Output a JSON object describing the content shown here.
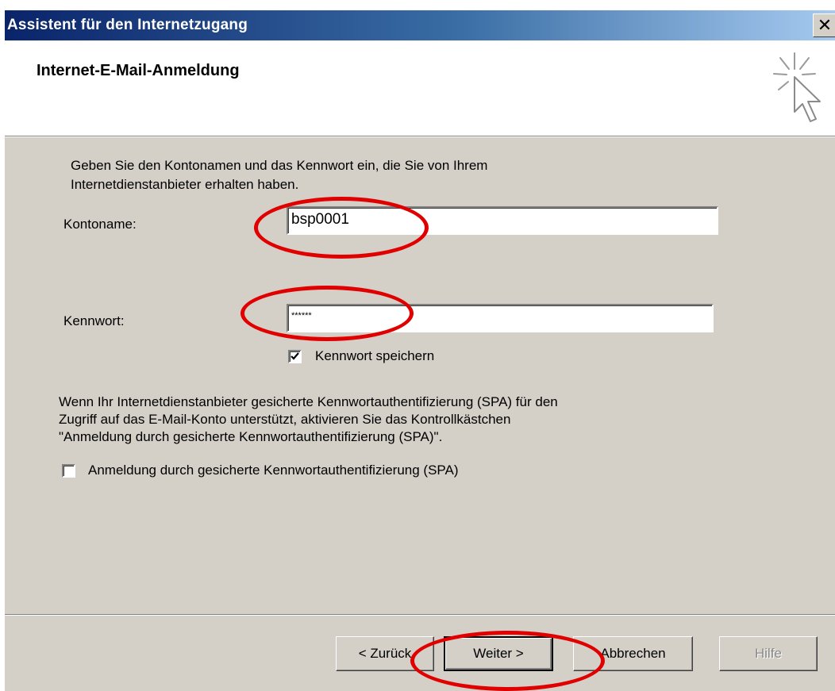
{
  "window": {
    "title": "Assistent für den Internetzugang",
    "close_glyph": "✕"
  },
  "header": {
    "title": "Internet-E-Mail-Anmeldung",
    "icon": "wizard-sparkle-cursor-icon"
  },
  "intro": {
    "line1": "Geben Sie den Kontonamen und das Kennwort ein, die Sie von Ihrem",
    "line2": "Internetdienstanbieter erhalten haben."
  },
  "account": {
    "label": "Kontoname:",
    "value": "bsp0001"
  },
  "password": {
    "label": "Kennwort:",
    "value": "******"
  },
  "save_password": {
    "label": "Kennwort speichern",
    "checked": true
  },
  "spa_info": {
    "line1": "Wenn Ihr Internetdienstanbieter gesicherte Kennwortauthentifizierung (SPA) für den",
    "line2": "Zugriff auf das E-Mail-Konto unterstützt, aktivieren Sie das Kontrollkästchen",
    "line3": "\"Anmeldung durch gesicherte Kennwortauthentifizierung (SPA)\"."
  },
  "spa_checkbox": {
    "label": "Anmeldung durch gesicherte Kennwortauthentifizierung (SPA)",
    "checked": false
  },
  "buttons": {
    "back": "< Zurück",
    "next": "Weiter >",
    "cancel": "Abbrechen",
    "help": "Hilfe"
  },
  "annotation_color": "#e00000"
}
